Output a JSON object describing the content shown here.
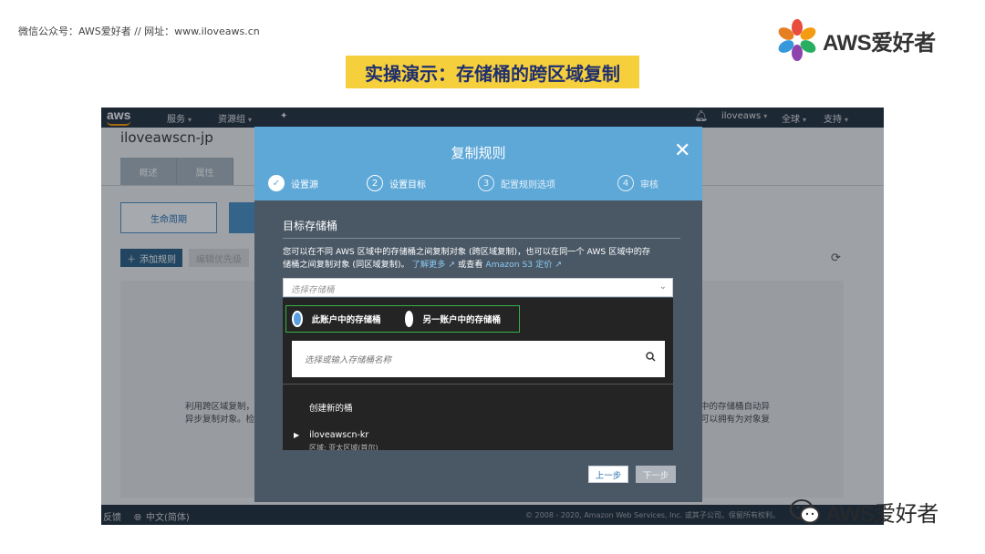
{
  "slide": {
    "header": "微信公众号：AWS爱好者  //  网址：www.iloveaws.cn",
    "brand": "AWS爱好者",
    "title": "实操演示：存储桶的跨区域复制",
    "watermark": "AWS爱好者"
  },
  "topnav": {
    "logo": "aws",
    "services": "服务",
    "resource_groups": "资源组",
    "account": "iloveaws",
    "region": "全球",
    "support": "支持"
  },
  "console": {
    "bucket_name": "iloveawscn-jp",
    "tabs": [
      "概述",
      "属性"
    ],
    "lifecycle_label": "生命周期",
    "add_rule_label": "添加规则",
    "edit_priority_label": "编辑优先级",
    "desc_left": [
      "利用跨区域复制，",
      "异步复制对象。检"
    ],
    "desc_right": [
      "中的存储桶自动异",
      "可以拥有为对象复"
    ]
  },
  "footer": {
    "feedback": "反馈",
    "language": "中文(简体)",
    "copyright": "© 2008 - 2020, Amazon Web Services, Inc. 或其子公司。保留所有权利。"
  },
  "modal": {
    "title": "复制规则",
    "steps": [
      {
        "num": "✓",
        "label": "设置源"
      },
      {
        "num": "2",
        "label": "设置目标"
      },
      {
        "num": "3",
        "label": "配置规则选项"
      },
      {
        "num": "4",
        "label": "审核"
      }
    ],
    "section_title": "目标存储桶",
    "help_text_1": "您可以在不同 AWS 区域中的存储桶之间复制对象 (跨区域复制)，也可以在同一个 AWS 区域中的存",
    "help_text_2": "储桶之间复制对象 (同区域复制)。",
    "learn_more": "了解更多",
    "or_view": "或查看",
    "pricing": "Amazon S3 定价",
    "select_placeholder": "选择存储桶",
    "radio_this_account": "此账户中的存储桶",
    "radio_other_account": "另一账户中的存储桶",
    "search_placeholder": "选择或输入存储桶名称",
    "create_new": "创建新的桶",
    "bucket_item": "iloveawscn-kr",
    "bucket_region": "区域: 亚太区域(首尔)",
    "prev_label": "上一步",
    "next_label": "下一步"
  },
  "colors": {
    "modal_header": "#5ea8d8",
    "modal_body": "#4a5866",
    "title_bg": "#f6cf3d",
    "radio_border": "#34b34a",
    "nav_bg": "#232f3e"
  }
}
